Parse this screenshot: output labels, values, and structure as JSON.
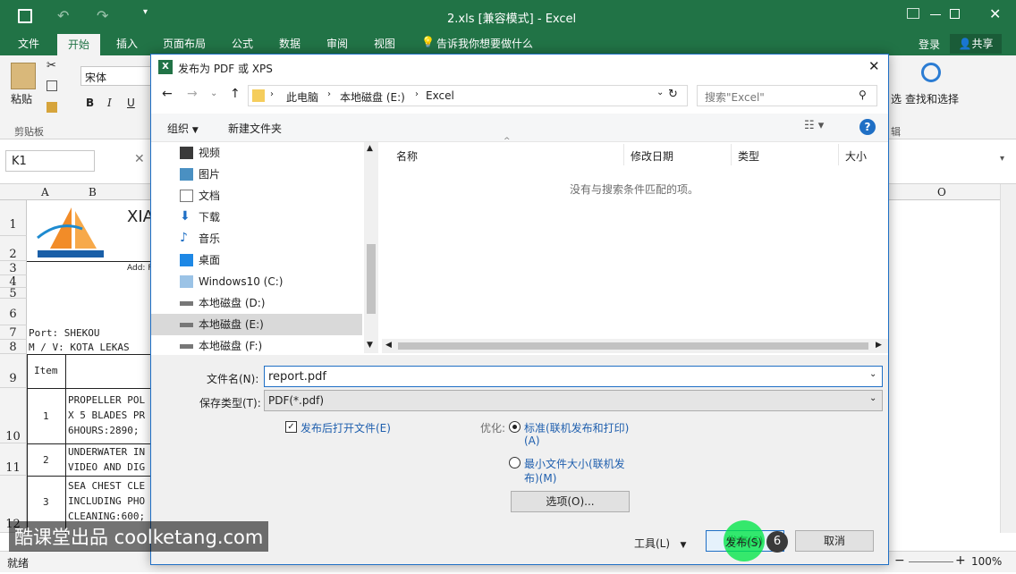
{
  "app": {
    "title": "2.xls  [兼容模式] - Excel",
    "undo_icon": "undo-icon",
    "redo_icon": "redo-icon"
  },
  "tabs": [
    "文件",
    "开始",
    "插入",
    "页面布局",
    "公式",
    "数据",
    "审阅",
    "视图"
  ],
  "tell_me": "告诉我你想要做什么",
  "account": {
    "login": "登录",
    "share": "共享"
  },
  "ribbon": {
    "paste": "粘贴",
    "clipboard": "剪贴板",
    "font_name": "宋体",
    "bold": "B",
    "italic": "I",
    "underline": "U",
    "select_fragment": "选",
    "find_select": "查找和选择",
    "edit_fragment": "辑"
  },
  "formula_bar": {
    "name_box": "K1"
  },
  "sheet": {
    "col_a": "A",
    "col_b": "B",
    "col_o": "O",
    "row_numbers": [
      "1",
      "2",
      "3",
      "4",
      "5",
      "6",
      "7",
      "8",
      "9",
      "10",
      "11",
      "12"
    ],
    "title_fragment": "XIA",
    "add_fragment": "Add: F",
    "port": "Port:  SHEKOU",
    "vessel": "M / V:  KOTA LEKAS",
    "item_header": "Item",
    "items": [
      {
        "no": "1",
        "lines": [
          "PROPELLER POL",
          "X 5 BLADES PR",
          "6HOURS:2890;"
        ]
      },
      {
        "no": "2",
        "lines": [
          "UNDERWATER IN",
          "VIDEO AND DIG"
        ]
      },
      {
        "no": "3",
        "lines": [
          "SEA CHEST CLE",
          "INCLUDING PHO",
          "CLEANING:600;"
        ]
      }
    ]
  },
  "status": {
    "ready": "就绪",
    "zoom": "100%"
  },
  "dialog": {
    "title": "发布为 PDF 或 XPS",
    "breadcrumb": [
      "此电脑",
      "本地磁盘 (E:)",
      "Excel"
    ],
    "search_placeholder": "搜索\"Excel\"",
    "organize": "组织",
    "new_folder": "新建文件夹",
    "nav_items": [
      {
        "label": "视频",
        "icon": "video-folder-icon"
      },
      {
        "label": "图片",
        "icon": "pictures-folder-icon"
      },
      {
        "label": "文档",
        "icon": "documents-folder-icon"
      },
      {
        "label": "下载",
        "icon": "download-folder-icon"
      },
      {
        "label": "音乐",
        "icon": "music-folder-icon"
      },
      {
        "label": "桌面",
        "icon": "desktop-folder-icon"
      },
      {
        "label": "Windows10 (C:)",
        "icon": "windows-drive-icon"
      },
      {
        "label": "本地磁盘 (D:)",
        "icon": "disk-drive-icon"
      },
      {
        "label": "本地磁盘 (E:)",
        "icon": "disk-drive-icon"
      },
      {
        "label": "本地磁盘 (F:)",
        "icon": "disk-drive-icon"
      }
    ],
    "columns": [
      "名称",
      "修改日期",
      "类型",
      "大小"
    ],
    "empty_message": "没有与搜索条件匹配的项。",
    "filename_label": "文件名(N):",
    "filename_value": "report.pdf",
    "filetype_label": "保存类型(T):",
    "filetype_value": "PDF(*.pdf)",
    "open_after_publish": "发布后打开文件(E)",
    "optimize_label": "优化:",
    "opt_standard": [
      "标准(联机发布和打印)",
      "(A)"
    ],
    "opt_minimum": [
      "最小文件大小(联机发",
      "布)(M)"
    ],
    "options_button": "选项(O)...",
    "tools": "工具(L)",
    "publish_button": "发布(S)",
    "cancel_button": "取消",
    "step_badge": "6"
  },
  "watermark": "酷课堂出品 coolketang.com"
}
